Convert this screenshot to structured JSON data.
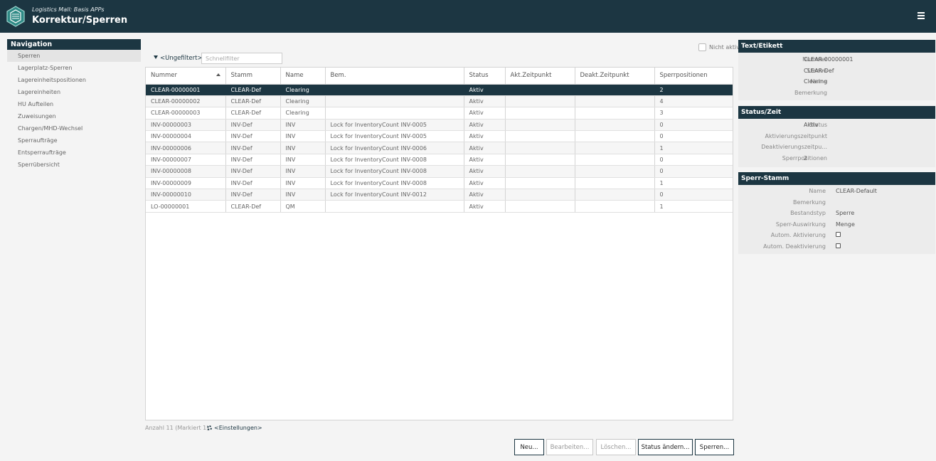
{
  "header": {
    "subtitle": "Logistics Mall: Basis APPs",
    "title": "Korrektur/Sperren"
  },
  "nav": {
    "title": "Navigation",
    "items": [
      {
        "label": "Sperren"
      },
      {
        "label": "Lagerplatz-Sperren"
      },
      {
        "label": "Lagereinheitspositionen"
      },
      {
        "label": "Lagereinheiten"
      },
      {
        "label": "HU Aufteilen"
      },
      {
        "label": "Zuweisungen"
      },
      {
        "label": "Chargen/MHD-Wechsel"
      },
      {
        "label": "Sperraufträge"
      },
      {
        "label": "Entsperraufträge"
      },
      {
        "label": "Sperrübersicht"
      }
    ]
  },
  "toolbar": {
    "filter_label": "<Ungefiltert>",
    "quickfilter_placeholder": "Schnellfilter",
    "inactive_label": "Nicht aktiv"
  },
  "table": {
    "columns": [
      "Nummer",
      "Stamm",
      "Name",
      "Bem.",
      "Status",
      "Akt.Zeitpunkt",
      "Deakt.Zeitpunkt",
      "Sperrpositionen"
    ],
    "rows": [
      [
        "CLEAR-00000001",
        "CLEAR-Def",
        "Clearing",
        "",
        "Aktiv",
        "",
        "",
        "2"
      ],
      [
        "CLEAR-00000002",
        "CLEAR-Def",
        "Clearing",
        "",
        "Aktiv",
        "",
        "",
        "4"
      ],
      [
        "CLEAR-00000003",
        "CLEAR-Def",
        "Clearing",
        "",
        "Aktiv",
        "",
        "",
        "3"
      ],
      [
        "INV-00000003",
        "INV-Def",
        "INV",
        "Lock for InventoryCount INV-0005",
        "Aktiv",
        "",
        "",
        "0"
      ],
      [
        "INV-00000004",
        "INV-Def",
        "INV",
        "Lock for InventoryCount INV-0005",
        "Aktiv",
        "",
        "",
        "0"
      ],
      [
        "INV-00000006",
        "INV-Def",
        "INV",
        "Lock for InventoryCount INV-0006",
        "Aktiv",
        "",
        "",
        "1"
      ],
      [
        "INV-00000007",
        "INV-Def",
        "INV",
        "Lock for InventoryCount INV-0008",
        "Aktiv",
        "",
        "",
        "0"
      ],
      [
        "INV-00000008",
        "INV-Def",
        "INV",
        "Lock for InventoryCount INV-0008",
        "Aktiv",
        "",
        "",
        "0"
      ],
      [
        "INV-00000009",
        "INV-Def",
        "INV",
        "Lock for InventoryCount INV-0008",
        "Aktiv",
        "",
        "",
        "1"
      ],
      [
        "INV-00000010",
        "INV-Def",
        "INV",
        "Lock for InventoryCount INV-0012",
        "Aktiv",
        "",
        "",
        "0"
      ],
      [
        "LO-00000001",
        "CLEAR-Def",
        "QM",
        "",
        "Aktiv",
        "",
        "",
        "1"
      ]
    ]
  },
  "footer": {
    "count_text": "Anzahl 11 (Markiert 1)",
    "settings_label": "<Einstellungen>"
  },
  "buttons": {
    "new": "Neu...",
    "edit": "Bearbeiten...",
    "delete": "Löschen...",
    "status": "Status ändern...",
    "lock": "Sperren..."
  },
  "panel_text": {
    "title": "Text/Etikett",
    "nummer_label": "Nummer",
    "nummer_value": "CLEAR-00000001",
    "stamm_label": "Stamm",
    "stamm_value": "CLEAR-Def",
    "name_label": "Name",
    "name_value": "Clearing",
    "bemerkung_label": "Bemerkung",
    "bemerkung_value": ""
  },
  "panel_status": {
    "title": "Status/Zeit",
    "status_label": "Status",
    "status_value": "Aktiv",
    "akt_label": "Aktivierungszeitpunkt",
    "akt_value": "",
    "deakt_label": "Deaktivierungszeitpu...",
    "deakt_value": "",
    "sperrpos_label": "Sperrpositionen",
    "sperrpos_value": "2"
  },
  "panel_sperr": {
    "title": "Sperr-Stamm",
    "name_label": "Name",
    "name_value": "CLEAR-Default",
    "bemerkung_label": "Bemerkung",
    "bemerkung_value": "",
    "bestand_label": "Bestandstyp",
    "bestand_value": "Sperre",
    "auswirkung_label": "Sperr-Auswirkung",
    "auswirkung_value": "Menge",
    "autoakt_label": "Autom. Aktivierung",
    "autoakt_checked": false,
    "autodeakt_label": "Autom. Deaktivierung",
    "autodeakt_checked": false
  },
  "colors": {
    "brand": "#1c3642"
  }
}
